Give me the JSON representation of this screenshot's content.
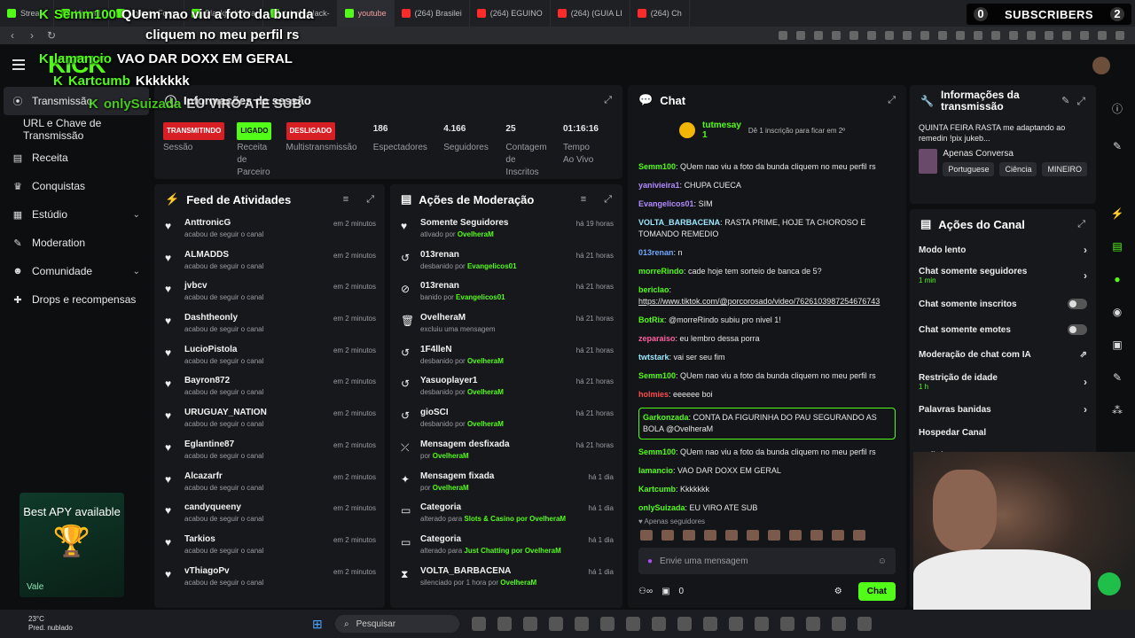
{
  "browser": {
    "tabs": [
      {
        "label": "Stream",
        "kind": "kick"
      },
      {
        "label": "Midpad",
        "kind": "other"
      },
      {
        "label": "Volante Form",
        "kind": "other"
      },
      {
        "label": "Blackjack Stra",
        "kind": "other"
      },
      {
        "label": "tabela-black-",
        "kind": "other"
      },
      {
        "label": "youtube",
        "kind": "active"
      },
      {
        "label": "(264) Brasilei",
        "kind": "yt"
      },
      {
        "label": "(264) EGUINO",
        "kind": "yt"
      },
      {
        "label": "(264) (GUIA LI",
        "kind": "yt"
      },
      {
        "label": "(264) Ch",
        "kind": "yt"
      }
    ],
    "url": "m"
  },
  "overlay": {
    "names": [
      {
        "user": "Semm100",
        "msg": "QUem nao viu a foto da bunda"
      },
      {
        "user": "",
        "msg": "cliquem no meu perfil rs"
      },
      {
        "user": "lamancio",
        "msg": "VAO DAR DOXX EM GERAL"
      },
      {
        "user": "Kartcumb",
        "msg": "Kkkkkkk"
      },
      {
        "user": "onlySuizada",
        "msg": "EU VIRO ATE SUB"
      }
    ],
    "subscribers_label": "SUBSCRIBERS",
    "subscribers_left": "0",
    "subscribers_right": "2"
  },
  "sidebar": {
    "items": [
      {
        "label": "Transmissão",
        "icon": "broadcast-icon",
        "active": true
      },
      {
        "label": "URL e Chave de Transmissão",
        "sub": true
      },
      {
        "label": "Receita",
        "icon": "revenue-icon"
      },
      {
        "label": "Conquistas",
        "icon": "trophy-icon"
      },
      {
        "label": "Estúdio",
        "icon": "studio-icon",
        "chevron": true
      },
      {
        "label": "Moderation",
        "icon": "wrench-icon"
      },
      {
        "label": "Comunidade",
        "icon": "community-icon",
        "chevron": true
      },
      {
        "label": "Drops e recompensas",
        "icon": "gift-icon"
      }
    ],
    "ad": {
      "title": "Best APY available",
      "tag": "Vale"
    }
  },
  "session": {
    "title": "Informações da sessão",
    "stats": [
      {
        "value": "TRANSMITINDO",
        "label": "Sessão",
        "badge": "red"
      },
      {
        "value": "LIGADO",
        "label": "Receita de Parceiro",
        "badge": "green"
      },
      {
        "value": "DESLIGADO",
        "label": "Multistransmissão",
        "badge": "red"
      },
      {
        "value": "186",
        "label": "Espectadores"
      },
      {
        "value": "4.166",
        "label": "Seguidores"
      },
      {
        "value": "25",
        "label": "Contagem de Inscritos"
      },
      {
        "value": "01:16:16",
        "label": "Tempo Ao Vivo"
      }
    ]
  },
  "feed": {
    "title": "Feed de Atividades",
    "rows": [
      {
        "name": "AnttronicG",
        "sub": "acabou de seguir o canal",
        "time": "em 2 minutos"
      },
      {
        "name": "ALMADDS",
        "sub": "acabou de seguir o canal",
        "time": "em 2 minutos"
      },
      {
        "name": "jvbcv",
        "sub": "acabou de seguir o canal",
        "time": "em 2 minutos"
      },
      {
        "name": "Dashtheonly",
        "sub": "acabou de seguir o canal",
        "time": "em 2 minutos"
      },
      {
        "name": "LucioPistola",
        "sub": "acabou de seguir o canal",
        "time": "em 2 minutos"
      },
      {
        "name": "Bayron872",
        "sub": "acabou de seguir o canal",
        "time": "em 2 minutos"
      },
      {
        "name": "URUGUAY_NATION",
        "sub": "acabou de seguir o canal",
        "time": "em 2 minutos"
      },
      {
        "name": "Eglantine87",
        "sub": "acabou de seguir o canal",
        "time": "em 2 minutos"
      },
      {
        "name": "Alcazarfr",
        "sub": "acabou de seguir o canal",
        "time": "em 2 minutos"
      },
      {
        "name": "candyqueeny",
        "sub": "acabou de seguir o canal",
        "time": "em 2 minutos"
      },
      {
        "name": "Tarkios",
        "sub": "acabou de seguir o canal",
        "time": "em 2 minutos"
      },
      {
        "name": "vThiagoPv",
        "sub": "acabou de seguir o canal",
        "time": "em 2 minutos"
      }
    ]
  },
  "moderation": {
    "title": "Ações de Moderação",
    "rows": [
      {
        "icon": "heart-icon",
        "name": "Somente Seguidores",
        "sub": "ativado por",
        "by": "OvelheraM",
        "time": "há 19 horas"
      },
      {
        "icon": "undo-icon",
        "name": "013renan",
        "sub": "desbanido por",
        "by": "Evangelicos01",
        "time": "há 21 horas"
      },
      {
        "icon": "ban-icon",
        "name": "013renan",
        "sub": "banido por",
        "by": "Evangelicos01",
        "time": "há 21 horas"
      },
      {
        "icon": "trash-icon",
        "name": "OvelheraM",
        "sub": "excluiu uma mensagem",
        "by": "",
        "time": "há 21 horas"
      },
      {
        "icon": "undo-icon",
        "name": "1F4lleN",
        "sub": "desbanido por",
        "by": "OvelheraM",
        "time": "há 21 horas"
      },
      {
        "icon": "undo-icon",
        "name": "Yasuoplayer1",
        "sub": "desbanido por",
        "by": "OvelheraM",
        "time": "há 21 horas"
      },
      {
        "icon": "undo-icon",
        "name": "gioSCI",
        "sub": "desbanido por",
        "by": "OvelheraM",
        "time": "há 21 horas"
      },
      {
        "icon": "unpin-icon",
        "name": "Mensagem desfixada",
        "sub": "por",
        "by": "OvelheraM",
        "time": "há 21 horas"
      },
      {
        "icon": "pin-icon",
        "name": "Mensagem fixada",
        "sub": "por",
        "by": "OvelheraM",
        "time": "há 1 dia"
      },
      {
        "icon": "category-icon",
        "name": "Categoria",
        "sub": "alterado para",
        "by": "Slots & Casino por OvelheraM",
        "time": "há 1 dia"
      },
      {
        "icon": "category-icon",
        "name": "Categoria",
        "sub": "alterado para",
        "by": "Just Chatting por OvelheraM",
        "time": "há 1 dia"
      },
      {
        "icon": "timeout-icon",
        "name": "VOLTA_BARBACENA",
        "sub": "silenciado por 1 hora por",
        "by": "OvelheraM",
        "time": "há 1 dia"
      }
    ]
  },
  "chat": {
    "title": "Chat",
    "sub_banner": {
      "user": "tutmesay",
      "count": "1",
      "msg": "Dê 1 inscrição para ficar em 2º"
    },
    "messages": [
      {
        "user": "Semm100",
        "color": "#53fc18",
        "text": "QUem nao viu a foto da bunda cliquem no meu perfil rs"
      },
      {
        "user": "yanivieira1",
        "color": "#b18cff",
        "text": "CHUPA CUECA"
      },
      {
        "user": "Evangelicos01",
        "color": "#b18cff",
        "text": "SIM"
      },
      {
        "user": "VOLTA_BARBACENA",
        "color": "#9be7ff",
        "text": "RASTA PRIME, HOJE TA CHOROSO E TOMANDO REMEDIO"
      },
      {
        "user": "013renan",
        "color": "#6fa8ff",
        "text": "n"
      },
      {
        "user": "morreRindo",
        "color": "#53fc18",
        "text": "cade hoje tem sorteio de banca de 5?"
      },
      {
        "user": "bericlao",
        "color": "#53fc18",
        "text": "https://www.tiktok.com/@porcorosado/video/7626103987254676743"
      },
      {
        "user": "BotRix",
        "color": "#53fc18",
        "text": "@morreRindo subiu pro nivel 1!"
      },
      {
        "user": "zeparaiso",
        "color": "#ff5fa2",
        "text": "eu lembro dessa porra"
      },
      {
        "user": "twtstark",
        "color": "#9be7ff",
        "text": "vai ser seu fim"
      },
      {
        "user": "Semm100",
        "color": "#53fc18",
        "text": "QUem nao viu a foto da bunda cliquem no meu perfil rs"
      },
      {
        "user": "holmies",
        "color": "#ff4b4b",
        "text": "eeeeee boi"
      },
      {
        "user": "Garkonzada",
        "color": "#53fc18",
        "text": "CONTA DA FIGURINHA DO PAU SEGURANDO AS BOLA @OvelheraM",
        "highlight": true
      },
      {
        "user": "Semm100",
        "color": "#53fc18",
        "text": "QUem nao viu a foto da bunda cliquem no meu perfil rs"
      },
      {
        "user": "lamancio",
        "color": "#53fc18",
        "text": "VAO DAR DOXX EM GERAL"
      },
      {
        "user": "Kartcumb",
        "color": "#53fc18",
        "text": "Kkkkkkk"
      },
      {
        "user": "onlySuizada",
        "color": "#53fc18",
        "text": "EU VIRO ATE SUB"
      }
    ],
    "followers_only": "Apenas seguidores",
    "placeholder": "Envie uma mensagem",
    "viewers_count": "0",
    "send_label": "Chat"
  },
  "stream_info": {
    "title": "Informações da transmissão",
    "stream_title": "QUINTA FEIRA RASTA me adaptando ao remedin !pix jukeb...",
    "category": "Apenas Conversa",
    "tags": [
      "Portuguese",
      "Ciência",
      "MINEIRO"
    ]
  },
  "channel_actions": {
    "title": "Ações do Canal",
    "rows": [
      {
        "label": "Modo lento",
        "sub": "",
        "control": "chevron"
      },
      {
        "label": "Chat somente seguidores",
        "sub": "1 min",
        "control": "chevron"
      },
      {
        "label": "Chat somente inscritos",
        "sub": "",
        "control": "toggle"
      },
      {
        "label": "Chat somente emotes",
        "sub": "",
        "control": "toggle"
      },
      {
        "label": "Moderação de chat com IA",
        "sub": "",
        "control": "external"
      },
      {
        "label": "Restrição de idade",
        "sub": "1 h",
        "control": "chevron"
      },
      {
        "label": "Palavras banidas",
        "sub": "",
        "control": "chevron"
      },
      {
        "label": "Hospedar Canal",
        "sub": "",
        "control": "none"
      },
      {
        "label": "Definir m",
        "sub": "",
        "control": "chevron"
      }
    ]
  },
  "taskbar": {
    "temp": "23°C",
    "weather": "Pred. nublado",
    "search_placeholder": "Pesquisar"
  }
}
